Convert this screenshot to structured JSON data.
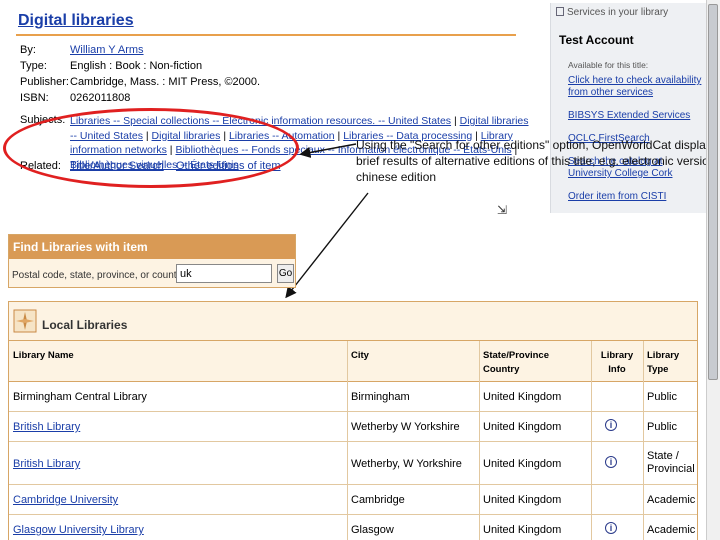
{
  "title": "Digital libraries",
  "meta": {
    "by_label": "By:",
    "by_value": "William Y Arms",
    "type_label": "Type:",
    "type_value": "English : Book : Non-fiction",
    "publisher_label": "Publisher:",
    "publisher_value": "Cambridge, Mass. : MIT Press, ©2000.",
    "isbn_label": "ISBN:",
    "isbn_value": "0262011808",
    "subjects_label": "Subjects:",
    "subjects": [
      "Libraries -- Special collections -- Electronic information resources. -- United States",
      "Digital libraries -- United States",
      "Digital libraries",
      "Libraries -- Automation",
      "Libraries -- Data processing",
      "Library information networks",
      "Bibliothèques -- Fonds spéciaux -- Information électronique -- États-Unis",
      "Bibliothèques virtuelles -- États-Unis"
    ],
    "related_label": "Related:",
    "related_links": [
      "Title/Author Search",
      "Other editions of item"
    ]
  },
  "side": {
    "header": "Services in your library",
    "account": "Test Account",
    "available": "Available for this title:",
    "links": [
      "Click here to check availability from other services",
      "BIBSYS Extended Services",
      "OCLC FirstSearch",
      "Search the catalog at University College Cork",
      "Order item from CISTI"
    ]
  },
  "annotation": "Using the \"Search for other editions\" option, OpenWorldCat displays brief results of alternative editions of this title, e.g. electronic version, chinese edition",
  "find": {
    "title": "Find Libraries with item",
    "label": "Postal code, state, province, or country:",
    "value": "uk",
    "go": "Go"
  },
  "local": {
    "title": "Local Libraries",
    "columns": [
      "Library Name",
      "City",
      "State/Province Country",
      "Library Info",
      "Library Type"
    ],
    "rows": [
      {
        "name": "Birmingham Central Library",
        "link": false,
        "city": "Birmingham",
        "country": "United Kingdom",
        "info": false,
        "type": "Public"
      },
      {
        "name": "British Library",
        "link": true,
        "city": "Wetherby W Yorkshire",
        "country": "United Kingdom",
        "info": true,
        "type": "Public"
      },
      {
        "name": "British Library",
        "link": true,
        "city": "Wetherby, W Yorkshire",
        "country": "United Kingdom",
        "info": true,
        "type": "State / Provincial"
      },
      {
        "name": "Cambridge University",
        "link": true,
        "city": "Cambridge",
        "country": "United Kingdom",
        "info": false,
        "type": "Academic"
      },
      {
        "name": "Glasgow University Library",
        "link": true,
        "city": "Glasgow",
        "country": "United Kingdom",
        "info": true,
        "type": "Academic"
      }
    ]
  },
  "colors": {
    "link": "#1a3ea8",
    "accent": "#d99a55",
    "annotation_red": "#e02020"
  }
}
